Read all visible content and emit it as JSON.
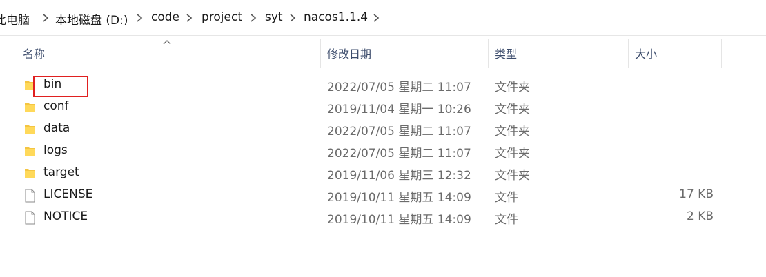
{
  "breadcrumb": {
    "items": [
      "此电脑",
      "本地磁盘 (D:)",
      "code",
      "project",
      "syt",
      "nacos1.1.4"
    ]
  },
  "columns": {
    "name": "名称",
    "date": "修改日期",
    "type": "类型",
    "size": "大小"
  },
  "files": [
    {
      "name": "bin",
      "date": "2022/07/05 星期二 11:07",
      "type": "文件夹",
      "size": "",
      "icon": "folder-icon"
    },
    {
      "name": "conf",
      "date": "2019/11/04 星期一 10:26",
      "type": "文件夹",
      "size": "",
      "icon": "folder-icon"
    },
    {
      "name": "data",
      "date": "2022/07/05 星期二 11:07",
      "type": "文件夹",
      "size": "",
      "icon": "folder-icon"
    },
    {
      "name": "logs",
      "date": "2022/07/05 星期二 11:07",
      "type": "文件夹",
      "size": "",
      "icon": "folder-icon"
    },
    {
      "name": "target",
      "date": "2019/11/06 星期三 12:32",
      "type": "文件夹",
      "size": "",
      "icon": "folder-icon"
    },
    {
      "name": "LICENSE",
      "date": "2019/10/11 星期五 14:09",
      "type": "文件",
      "size": "17 KB",
      "icon": "file-icon"
    },
    {
      "name": "NOTICE",
      "date": "2019/10/11 星期五 14:09",
      "type": "文件",
      "size": "2 KB",
      "icon": "file-icon"
    }
  ],
  "colors": {
    "folder": "#f4c542",
    "highlight": "#e02020"
  }
}
